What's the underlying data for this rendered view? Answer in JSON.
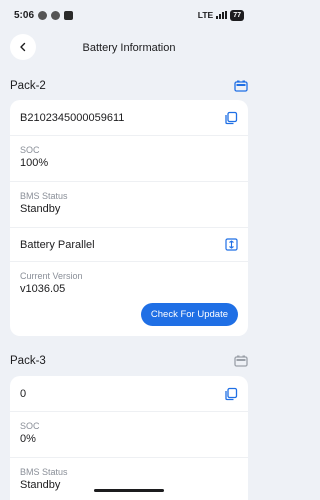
{
  "status_bar": {
    "time": "5:06",
    "network": "LTE",
    "battery": "77"
  },
  "header": {
    "title": "Battery Information"
  },
  "packs": [
    {
      "title": "Pack-2",
      "serial": "B2102345000059611",
      "soc_label": "SOC",
      "soc_value": "100%",
      "bms_label": "BMS Status",
      "bms_value": "Standby",
      "parallel_label": "Battery Parallel",
      "version_label": "Current Version",
      "version_value": "v1036.05",
      "update_button": "Check For Update"
    },
    {
      "title": "Pack-3",
      "serial": "0",
      "soc_label": "SOC",
      "soc_value": "0%",
      "bms_label": "BMS Status",
      "bms_value": "Standby"
    }
  ],
  "colors": {
    "accent": "#1f6fe5",
    "background": "#eef1f6",
    "card": "#ffffff",
    "muted": "#8a8f98"
  },
  "icons": [
    "back-arrow-icon",
    "battery-pack-icon",
    "copy-icon",
    "battery-parallel-icon"
  ]
}
